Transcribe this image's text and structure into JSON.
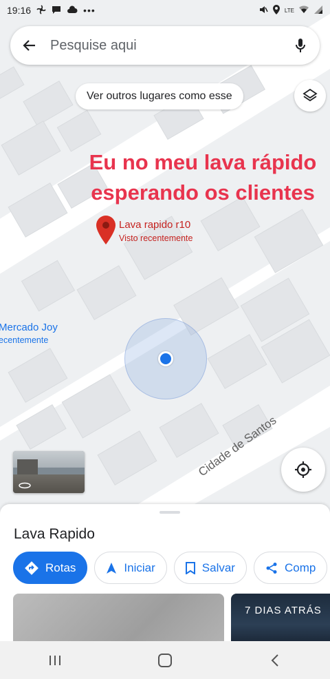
{
  "status_bar": {
    "time": "19:16",
    "network_label": "LTE"
  },
  "search": {
    "placeholder": "Pesquise aqui"
  },
  "map": {
    "more_places_chip": "Ver outros lugares como esse",
    "caption_line1": "Eu no meu lava rápido",
    "caption_line2": "esperando os clientes",
    "pin": {
      "title": "Lava rapido r10",
      "subtitle": "Visto recentemente"
    },
    "poi": {
      "title": "Mercado Joy",
      "subtitle": "ecentemente"
    },
    "street_label": "Cidade de Santos"
  },
  "sheet": {
    "title": "Lava Rapido",
    "actions": [
      {
        "label": "Rotas",
        "icon": "directions-icon"
      },
      {
        "label": "Iniciar",
        "icon": "navigation-arrow-icon"
      },
      {
        "label": "Salvar",
        "icon": "bookmark-icon"
      },
      {
        "label": "Comp",
        "icon": "share-icon"
      }
    ],
    "photo_badge": "7 DIAS ATRÁS"
  },
  "colors": {
    "accent": "#1a73e8",
    "caption": "#e8344e",
    "pin": "#c5221f"
  }
}
